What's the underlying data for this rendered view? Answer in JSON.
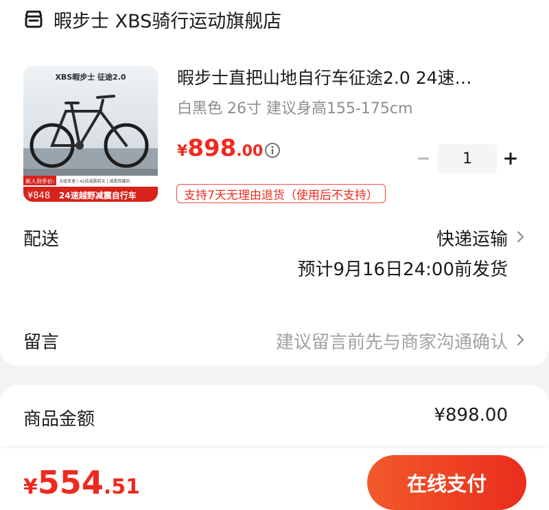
{
  "store": {
    "name": "暇步士 XBS骑行运动旗舰店",
    "icon": "store-icon"
  },
  "product": {
    "image": {
      "brand_title": "XBS暇步士 征途2.0",
      "promo_newuser": "新人到手价:",
      "promo_price": "¥848",
      "promo_features": "五级变速 | 42齿减震前叉 | 减震双碟刹",
      "promo_headline": "24速越野减震自行车"
    },
    "title": "暇步士直把山地自行车征途2.0 24速…",
    "variant": "白黑色 26寸 建议身高155-175cm",
    "price_symbol": "¥",
    "price_integer": "898",
    "price_decimal": ".00",
    "quantity": "1",
    "return_policy": "支持7天无理由退货（使用后不支持）"
  },
  "delivery": {
    "label": "配送",
    "method": "快递运输",
    "estimate": "预计9月16日24:00前发货"
  },
  "message": {
    "label": "留言",
    "placeholder": "建议留言前先与商家沟通确认"
  },
  "summary": {
    "goods_amount_label": "商品金额",
    "goods_amount_value": "¥898.00"
  },
  "checkout": {
    "total_symbol": "¥",
    "total_integer": "554",
    "total_decimal": ".51",
    "pay_label": "在线支付"
  },
  "colors": {
    "accent_red": "#ee2a1f",
    "pay_gradient_start": "#f25a2a",
    "pay_gradient_end": "#ea2d1d"
  }
}
